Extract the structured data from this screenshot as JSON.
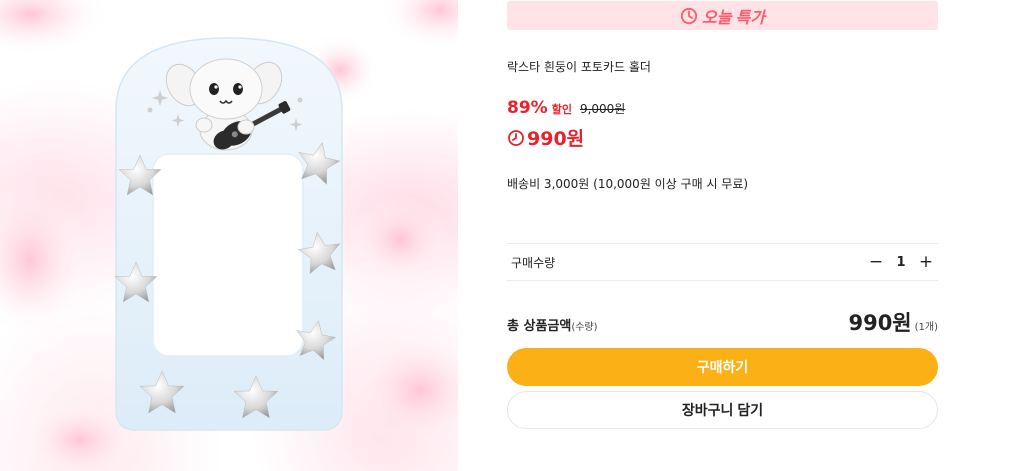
{
  "deal_banner": {
    "icon": "clock-icon",
    "today_label": "오늘",
    "special_label": "특가",
    "color": "#ff5a6a"
  },
  "product": {
    "name": "락스타 흰둥이 포토카드 홀더",
    "discount_percent": "89%",
    "discount_label": "할인",
    "original_price": "9,000원",
    "sale_price": "990원",
    "shipping": "배송비 3,000원 (10,000원 이상 구매 시 무료)"
  },
  "quantity": {
    "label": "구매수량",
    "value": "1",
    "minus": "−",
    "plus": "+"
  },
  "total": {
    "label": "총 상품금액",
    "label_sub": "(수량)",
    "amount": "990원",
    "count": "(1개)"
  },
  "buttons": {
    "buy_label": "구매하기",
    "cart_label": "장바구니 담기"
  },
  "colors": {
    "accent_red": "#e8232b",
    "buy_button": "#fbb116",
    "banner_bg": "#ffe3e6"
  }
}
